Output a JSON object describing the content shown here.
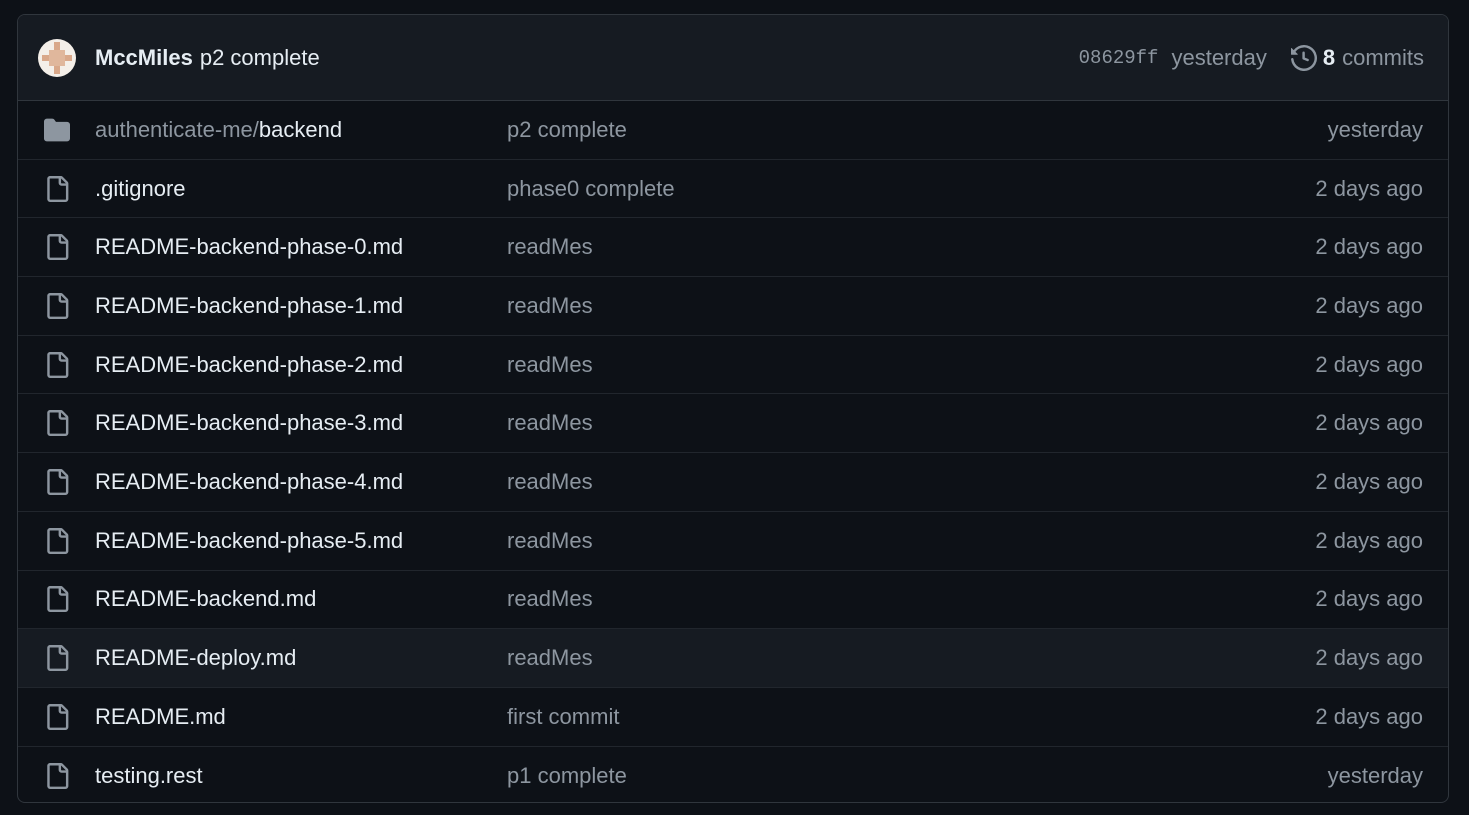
{
  "latest_commit": {
    "author": "MccMiles",
    "message": "p2 complete",
    "sha": "08629ff",
    "time": "yesterday",
    "commit_count": "8",
    "commit_label": "commits"
  },
  "files": [
    {
      "type": "folder",
      "prefix": "authenticate-me/",
      "name": "backend",
      "message": "p2 complete",
      "age": "yesterday"
    },
    {
      "type": "file",
      "name": ".gitignore",
      "message": "phase0 complete",
      "age": "2 days ago"
    },
    {
      "type": "file",
      "name": "README-backend-phase-0.md",
      "message": "readMes",
      "age": "2 days ago"
    },
    {
      "type": "file",
      "name": "README-backend-phase-1.md",
      "message": "readMes",
      "age": "2 days ago"
    },
    {
      "type": "file",
      "name": "README-backend-phase-2.md",
      "message": "readMes",
      "age": "2 days ago"
    },
    {
      "type": "file",
      "name": "README-backend-phase-3.md",
      "message": "readMes",
      "age": "2 days ago"
    },
    {
      "type": "file",
      "name": "README-backend-phase-4.md",
      "message": "readMes",
      "age": "2 days ago"
    },
    {
      "type": "file",
      "name": "README-backend-phase-5.md",
      "message": "readMes",
      "age": "2 days ago"
    },
    {
      "type": "file",
      "name": "README-backend.md",
      "message": "readMes",
      "age": "2 days ago"
    },
    {
      "type": "file",
      "name": "README-deploy.md",
      "message": "readMes",
      "age": "2 days ago"
    },
    {
      "type": "file",
      "name": "README.md",
      "message": "first commit",
      "age": "2 days ago"
    },
    {
      "type": "file",
      "name": "testing.rest",
      "message": "p1 complete",
      "age": "yesterday"
    }
  ],
  "colors": {
    "background": "#0d1117",
    "header_background": "#161b22",
    "border": "#30363d",
    "text_primary": "#e6edf3",
    "text_muted": "#8d96a0"
  }
}
